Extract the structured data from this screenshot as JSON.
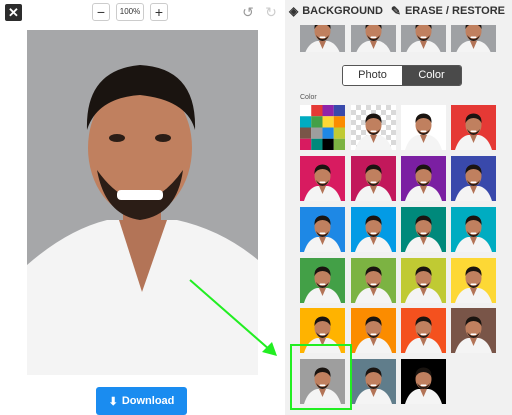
{
  "toolbar": {
    "close_label": "✕",
    "zoom_out_label": "−",
    "zoom_value": "100%",
    "zoom_in_label": "+",
    "undo_icon": "undo-icon",
    "redo_icon": "redo-icon"
  },
  "download": {
    "label": "Download",
    "icon": "download-icon",
    "color": "#1a8cf0"
  },
  "panel": {
    "background_tab": "BACKGROUND",
    "erase_tab": "ERASE / RESTORE",
    "toggle": {
      "photo": "Photo",
      "color": "Color",
      "selected": "Color"
    },
    "color_section_label": "Color"
  },
  "swatches": [
    {
      "name": "palette",
      "color": "palette"
    },
    {
      "name": "transparent",
      "color": "checker"
    },
    {
      "name": "white",
      "color": "#ffffff"
    },
    {
      "name": "red",
      "color": "#e53935"
    },
    {
      "name": "pink",
      "color": "#d81b60"
    },
    {
      "name": "magenta",
      "color": "#c2185b"
    },
    {
      "name": "purple",
      "color": "#7b1fa2"
    },
    {
      "name": "indigo",
      "color": "#3949ab"
    },
    {
      "name": "blue",
      "color": "#1e88e5"
    },
    {
      "name": "sky",
      "color": "#039be5"
    },
    {
      "name": "teal",
      "color": "#00897b"
    },
    {
      "name": "cyan",
      "color": "#00acc1"
    },
    {
      "name": "green",
      "color": "#43a047"
    },
    {
      "name": "light-green",
      "color": "#7cb342"
    },
    {
      "name": "lime",
      "color": "#c0ca33"
    },
    {
      "name": "yellow",
      "color": "#fdd835"
    },
    {
      "name": "amber",
      "color": "#ffb300"
    },
    {
      "name": "orange",
      "color": "#fb8c00"
    },
    {
      "name": "deep-orange",
      "color": "#f4511e"
    },
    {
      "name": "brown",
      "color": "#795548"
    },
    {
      "name": "gray",
      "color": "#9e9e9e"
    },
    {
      "name": "slate",
      "color": "#607d8b"
    },
    {
      "name": "black",
      "color": "#000000"
    }
  ],
  "selected_swatch": "gray",
  "annotation": {
    "color": "#22ee22"
  }
}
